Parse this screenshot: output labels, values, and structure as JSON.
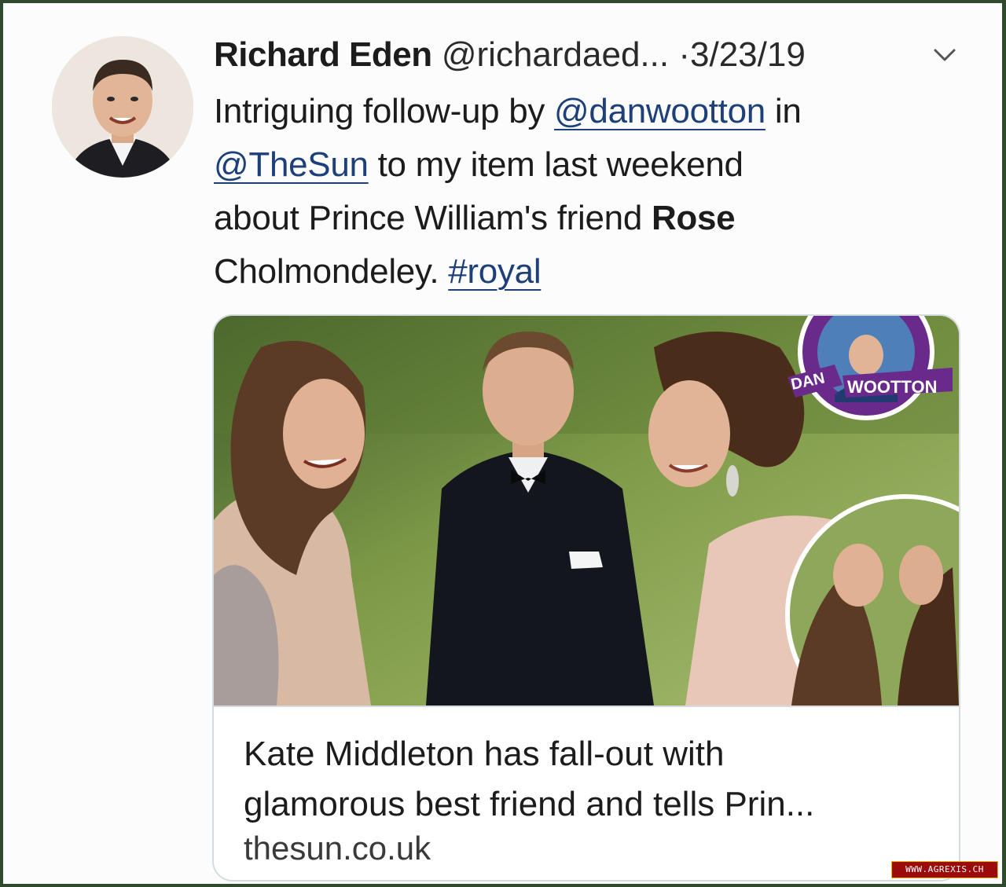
{
  "tweet": {
    "author_name": "Richard Eden",
    "handle": "@richardaed...",
    "separator": "·",
    "date": "3/23/19",
    "text": {
      "l1_a": "Intriguing follow-up by ",
      "l1_mention": "@danwootton",
      "l1_b": " in",
      "l2_mention": "@TheSun",
      "l2_b": " to my item last weekend",
      "l3_a": "about Prince William's friend ",
      "l3_bold": "Rose",
      "l4_a": "Cholmondeley. ",
      "l4_hashtag": "#royal"
    }
  },
  "card": {
    "overlay_brand_1": "DAN",
    "overlay_brand_2": "WOOTTON",
    "title_line_1": "Kate Middleton has fall-out with",
    "title_line_2": "glamorous best friend and tells Prin...",
    "domain": "thesun.co.uk"
  },
  "watermark": "WWW.AGREXIS.CH",
  "colors": {
    "link": "#1d3f7a",
    "frame": "#2f4a2c",
    "brand_purple": "#6a2a8c",
    "watermark_bg": "#9b0b0b"
  },
  "icons": {
    "menu": "chevron-down-icon"
  }
}
